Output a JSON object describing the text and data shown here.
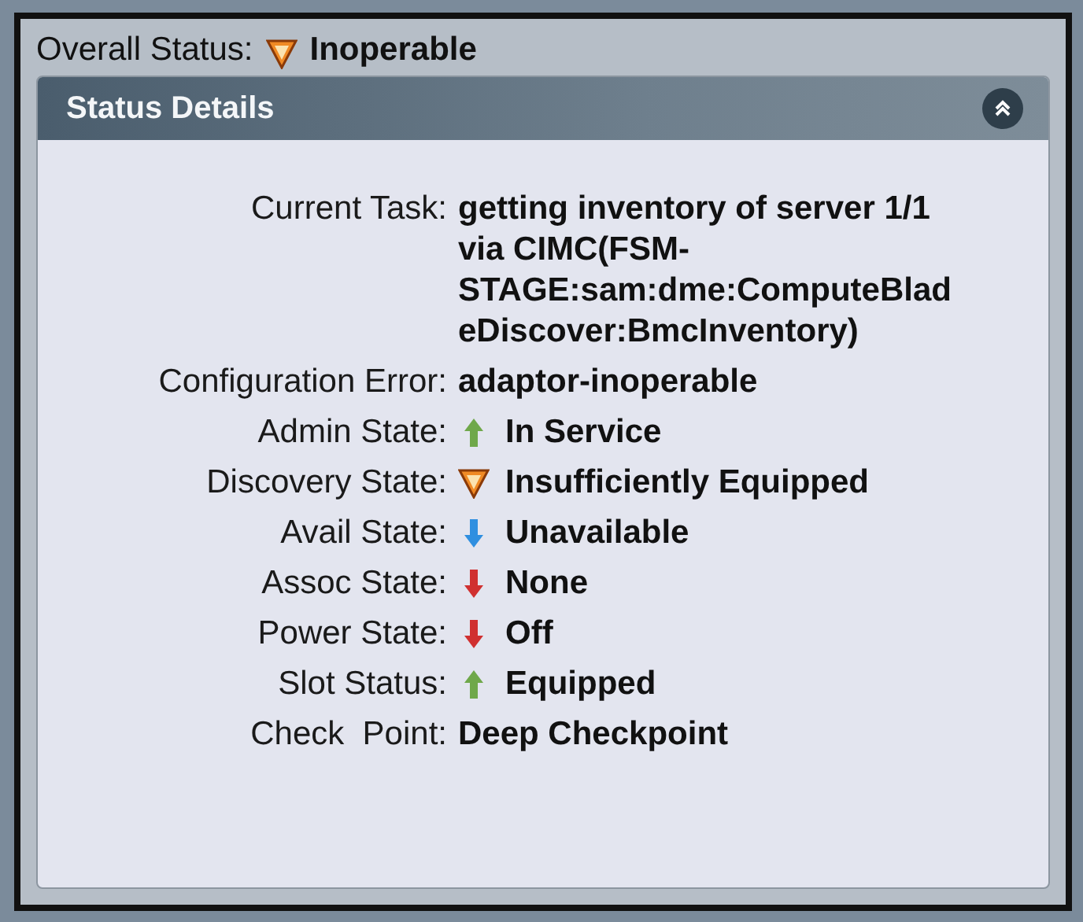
{
  "overall_status": {
    "label": "Overall Status:",
    "value": "Inoperable",
    "kind": "warning"
  },
  "panel": {
    "title": "Status Details",
    "expanded": true
  },
  "rows": [
    {
      "label": "Current Task:",
      "value": "getting inventory of server 1/1 via CIMC(FSM-STAGE:sam:dme:ComputeBladeDiscover:BmcInventory)"
    },
    {
      "label": "Configuration Error:",
      "value": "adaptor-inoperable"
    },
    {
      "label": "Admin State:",
      "value": "In Service",
      "kind": "up",
      "color": "#6fa84a"
    },
    {
      "label": "Discovery State:",
      "value": "Insufficiently Equipped",
      "kind": "warning"
    },
    {
      "label": "Avail State:",
      "value": "Unavailable",
      "kind": "down",
      "color": "#2f8fe0"
    },
    {
      "label": "Assoc State:",
      "value": "None",
      "kind": "down",
      "color": "#d03030"
    },
    {
      "label": "Power State:",
      "value": "Off",
      "kind": "down",
      "color": "#d03030"
    },
    {
      "label": "Slot Status:",
      "value": "Equipped",
      "kind": "up",
      "color": "#6fa84a"
    },
    {
      "label": "Check  Point:",
      "value": "Deep Checkpoint"
    }
  ]
}
